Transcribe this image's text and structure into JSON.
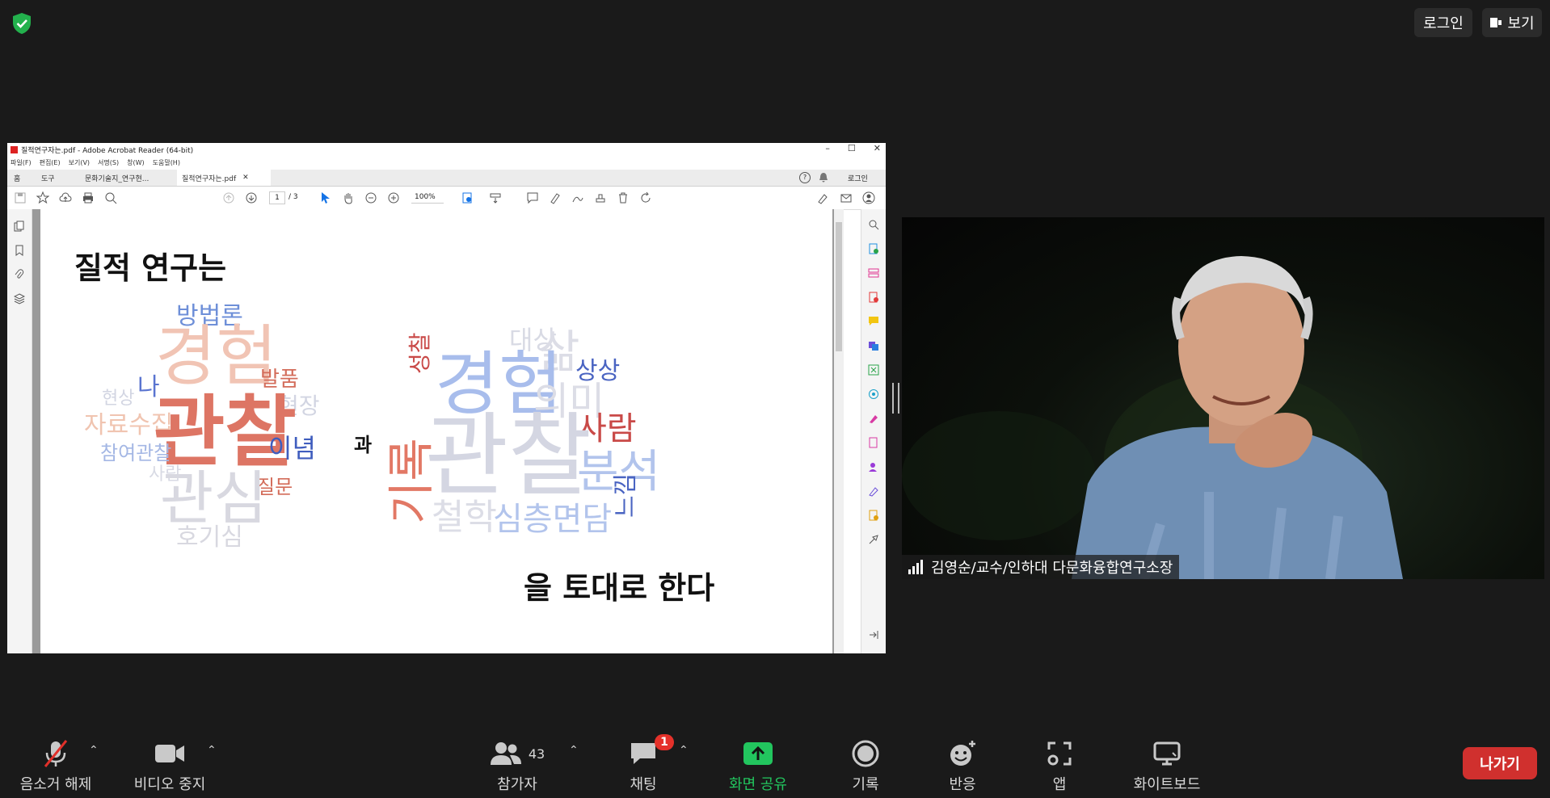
{
  "top": {
    "login_label": "로그인",
    "view_label": "보기"
  },
  "acrobat": {
    "title": "질적연구자는.pdf - Adobe Acrobat Reader (64-bit)",
    "menu": [
      "파일(F)",
      "편집(E)",
      "보기(V)",
      "서명(S)",
      "창(W)",
      "도움말(H)"
    ],
    "tabs": {
      "home": "홈",
      "tools": "도구",
      "doc1": "문화기술지_연구현...",
      "doc2": "질적연구자는.pdf"
    },
    "login_label": "로그인",
    "page_current": "1",
    "page_total": "/ 3",
    "zoom": "100%",
    "slide": {
      "heading": "질적 연구는",
      "connector": "과",
      "footer": "을 토대로 한다",
      "cloud1": [
        "방법론",
        "경험",
        "발품",
        "나",
        "현상",
        "현장",
        "자료수집",
        "관찰",
        "이념",
        "참여관찰",
        "사람",
        "질문",
        "관심",
        "호기심"
      ],
      "cloud2": [
        "대상",
        "삶",
        "상상",
        "성찰",
        "경험",
        "의미",
        "사람",
        "관찰",
        "분석",
        "기록",
        "느낌",
        "철학",
        "심층면담"
      ]
    }
  },
  "video": {
    "participant_name": "김영순/교수/인하대 다문화융합연구소장"
  },
  "toolbar": {
    "mute_label": "음소거 해제",
    "video_label": "비디오 중지",
    "participants_label": "참가자",
    "participants_count": "43",
    "chat_label": "채팅",
    "chat_badge": "1",
    "share_label": "화면 공유",
    "record_label": "기록",
    "react_label": "반응",
    "apps_label": "앱",
    "whiteboard_label": "화이트보드",
    "leave_label": "나가기"
  },
  "colors": {
    "share_green": "#22c55e",
    "leave_red": "#d0302e",
    "badge_red": "#e5312a"
  }
}
